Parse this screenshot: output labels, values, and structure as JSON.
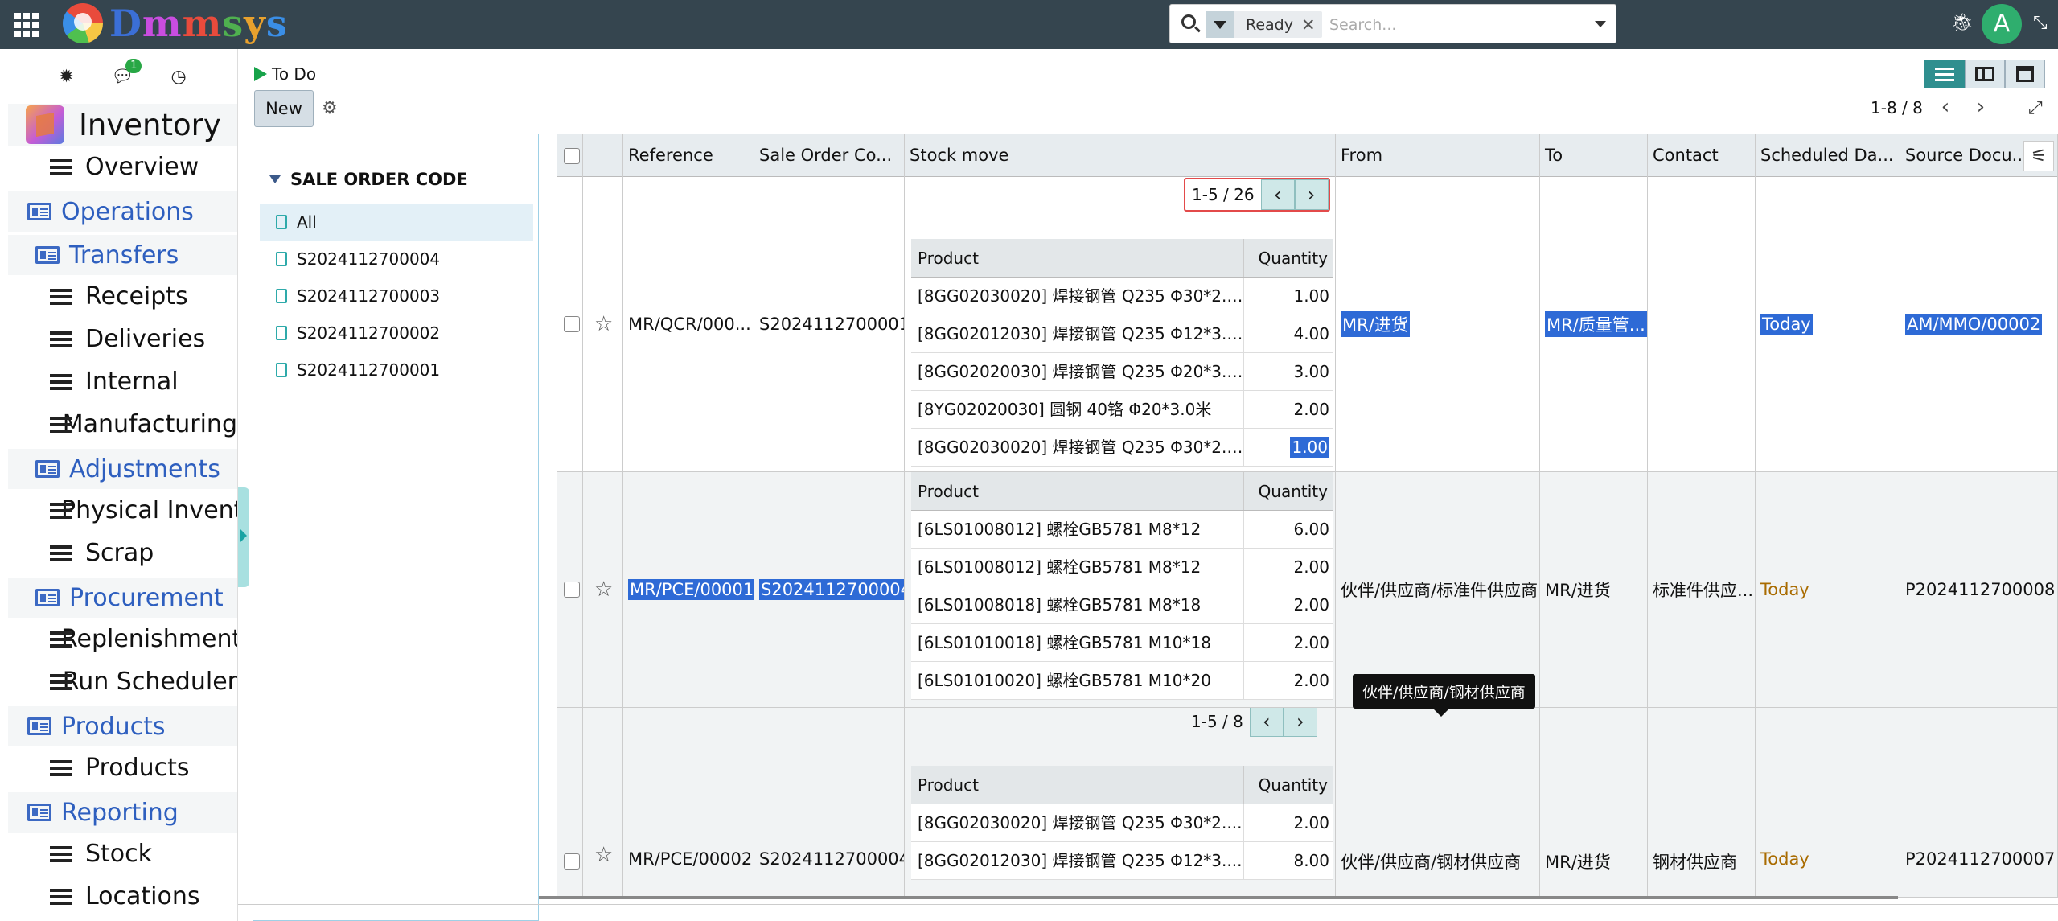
{
  "topbar": {
    "brand": "Dmmsys",
    "search": {
      "facet_label": "Ready",
      "placeholder": "Search..."
    },
    "avatar_letter": "A"
  },
  "sidebar": {
    "chat_badge": "1",
    "app_name": "Inventory",
    "menu": [
      {
        "label": "Overview",
        "type": "item"
      },
      {
        "label": "Operations",
        "type": "group"
      },
      {
        "label": "Transfers",
        "type": "subgroup"
      },
      {
        "label": "Receipts",
        "type": "item"
      },
      {
        "label": "Deliveries",
        "type": "item"
      },
      {
        "label": "Internal",
        "type": "item"
      },
      {
        "label": "Manufacturing",
        "type": "item"
      },
      {
        "label": "Adjustments",
        "type": "subgroup"
      },
      {
        "label": "Physical Invent",
        "type": "item"
      },
      {
        "label": "Scrap",
        "type": "item"
      },
      {
        "label": "Procurement",
        "type": "subgroup"
      },
      {
        "label": "Replenishment",
        "type": "item"
      },
      {
        "label": "Run Scheduler",
        "type": "item"
      },
      {
        "label": "Products",
        "type": "group"
      },
      {
        "label": "Products",
        "type": "item"
      },
      {
        "label": "Reporting",
        "type": "group"
      },
      {
        "label": "Stock",
        "type": "item"
      },
      {
        "label": "Locations",
        "type": "item"
      }
    ]
  },
  "control": {
    "breadcrumb": "To Do",
    "new_label": "New",
    "pager": "1-8 / 8"
  },
  "search_panel": {
    "header": "SALE ORDER CODE",
    "items": [
      "All",
      "S2024112700004",
      "S2024112700003",
      "S2024112700002",
      "S2024112700001"
    ]
  },
  "table": {
    "headers": [
      "Reference",
      "Sale Order Co...",
      "Stock move",
      "From",
      "To",
      "Contact",
      "Scheduled Da...",
      "Source Docu..."
    ],
    "sub_headers": {
      "product": "Product",
      "quantity": "Quantity"
    },
    "rows": [
      {
        "reference": "MR/QCR/000...",
        "sale_order": "S2024112700001",
        "from": "MR/进货",
        "to": "MR/质量管...",
        "contact": "",
        "scheduled": "Today",
        "source": "AM/MMO/00002",
        "moves_pager": "1-5 / 26",
        "moves": [
          {
            "product": "[8GG02030020] 焊接钢管 Q235 Φ30*2.0...",
            "qty": "1.00"
          },
          {
            "product": "[8GG02012030] 焊接钢管 Q235 Φ12*3.0...",
            "qty": "4.00"
          },
          {
            "product": "[8GG02020030] 焊接钢管 Q235 Φ20*3.0...",
            "qty": "3.00"
          },
          {
            "product": "[8YG02020030] 圆钢 40铬 Φ20*3.0米",
            "qty": "2.00"
          },
          {
            "product": "[8GG02030020] 焊接钢管 Q235 Φ30*2.0...",
            "qty": "1.00"
          }
        ]
      },
      {
        "reference": "MR/PCE/00001",
        "sale_order": "S2024112700004",
        "from": "伙伴/供应商/标准件供应商",
        "to": "MR/进货",
        "contact": "标准件供应...",
        "scheduled": "Today",
        "source": "P2024112700008",
        "moves": [
          {
            "product": "[6LS01008012] 螺栓GB5781 M8*12",
            "qty": "6.00"
          },
          {
            "product": "[6LS01008012] 螺栓GB5781 M8*12",
            "qty": "2.00"
          },
          {
            "product": "[6LS01008018] 螺栓GB5781 M8*18",
            "qty": "2.00"
          },
          {
            "product": "[6LS01010018] 螺栓GB5781 M10*18",
            "qty": "2.00"
          },
          {
            "product": "[6LS01010020] 螺栓GB5781 M10*20",
            "qty": "2.00"
          }
        ]
      },
      {
        "reference": "MR/PCE/00002",
        "sale_order": "S2024112700004",
        "from": "伙伴/供应商/钢材供应商",
        "to": "MR/进货",
        "contact": "钢材供应商",
        "scheduled": "Today",
        "source": "P2024112700007",
        "moves_pager": "1-5 / 8",
        "moves": [
          {
            "product": "[8GG02030020] 焊接钢管 Q235 Φ30*2....",
            "qty": "2.00"
          },
          {
            "product": "[8GG02012030] 焊接钢管 Q235 Φ12*3....",
            "qty": "8.00"
          }
        ]
      }
    ]
  },
  "tooltip": "伙伴/供应商/钢材供应商",
  "colors": {
    "topbar": "#35454f",
    "accent": "#2e5fbf",
    "selection": "#2e6ad6",
    "today": "#a96b00"
  }
}
